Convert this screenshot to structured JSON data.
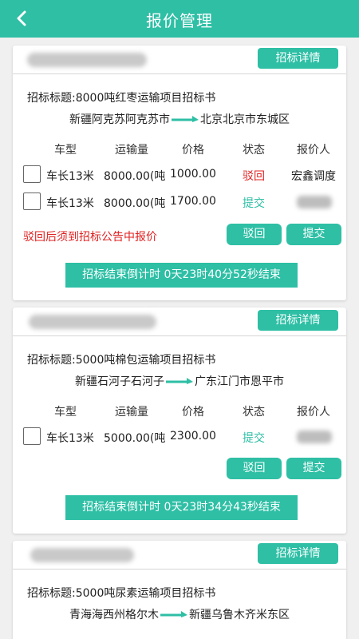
{
  "header": {
    "title": "报价管理"
  },
  "columns": [
    "车型",
    "运输量",
    "价格",
    "状态",
    "报价人"
  ],
  "detail_label": "招标详情",
  "reject_label": "驳回",
  "submit_label": "提交",
  "cards": [
    {
      "bid_title": "招标标题:8000吨红枣运输项目招标书",
      "from": "新疆阿克苏阿克苏市",
      "to": "北京北京市东城区",
      "rows": [
        {
          "type": "车长13米",
          "volume": "8000.00(吨",
          "price": "1000.00",
          "status": "驳回",
          "bidder": "宏鑫调度"
        },
        {
          "type": "车长13米",
          "volume": "8000.00(吨",
          "price": "1700.00",
          "status": "提交",
          "bidder": ""
        }
      ],
      "warning": "驳回后须到招标公告中报价",
      "countdown": "招标结束倒计时 0天23时40分52秒结束"
    },
    {
      "bid_title": "招标标题:5000吨棉包运输项目招标书",
      "from": "新疆石河子石河子",
      "to": "广东江门市恩平市",
      "rows": [
        {
          "type": "车长13米",
          "volume": "5000.00(吨",
          "price": "2300.00",
          "status": "提交",
          "bidder": ""
        }
      ],
      "countdown": "招标结束倒计时 0天23时34分43秒结束"
    },
    {
      "bid_title": "招标标题:5000吨尿素运输项目招标书",
      "from": "青海海西州格尔木",
      "to": "新疆乌鲁木齐米东区"
    }
  ],
  "colors": {
    "accent": "#2ebfa5",
    "danger": "#e02020"
  }
}
